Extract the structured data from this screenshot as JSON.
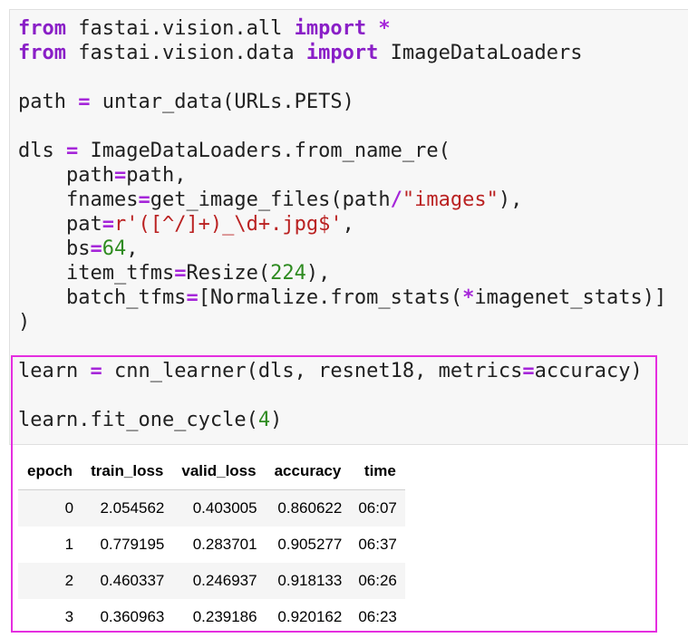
{
  "code": {
    "line1": {
      "kw1": "from",
      "mid": " fastai.vision.all ",
      "kw2": "import",
      "sp": " ",
      "star": "*"
    },
    "line2": {
      "kw1": "from",
      "mid": " fastai.vision.data ",
      "kw2": "import",
      "rest": " ImageDataLoaders"
    },
    "line4": {
      "a": "path ",
      "eq": "=",
      "b": " untar_data(URLs.PETS)"
    },
    "line6": {
      "a": "dls ",
      "eq": "=",
      "b": " ImageDataLoaders.from_name_re("
    },
    "line7": {
      "a": "    path",
      "eq": "=",
      "b": "path,"
    },
    "line8": {
      "a": "    fnames",
      "eq": "=",
      "b": "get_image_files(path",
      "slash": "/",
      "str": "\"images\"",
      "c": "),"
    },
    "line9": {
      "a": "    pat",
      "eq": "=",
      "str": "r'([^/]+)_\\d+.jpg$'",
      "c": ","
    },
    "line10": {
      "a": "    bs",
      "eq": "=",
      "num": "64",
      "c": ","
    },
    "line11": {
      "a": "    item_tfms",
      "eq": "=",
      "b": "Resize(",
      "num": "224",
      "c": "),"
    },
    "line12": {
      "a": "    batch_tfms",
      "eq": "=",
      "b": "[Normalize.from_stats(",
      "star": "*",
      "c": "imagenet_stats)]"
    },
    "line13": {
      "a": ")"
    },
    "line15": {
      "a": "learn ",
      "eq": "=",
      "b": " cnn_learner(dls, resnet18, metrics",
      "eq2": "=",
      "c": "accuracy)"
    },
    "line17": {
      "a": "learn.fit_one_cycle(",
      "num": "4",
      "c": ")"
    }
  },
  "output_table": {
    "headers": [
      "epoch",
      "train_loss",
      "valid_loss",
      "accuracy",
      "time"
    ],
    "rows": [
      [
        "0",
        "2.054562",
        "0.403005",
        "0.860622",
        "06:07"
      ],
      [
        "1",
        "0.779195",
        "0.283701",
        "0.905277",
        "06:37"
      ],
      [
        "2",
        "0.460337",
        "0.246937",
        "0.918133",
        "06:26"
      ],
      [
        "3",
        "0.360963",
        "0.239186",
        "0.920162",
        "06:23"
      ]
    ]
  },
  "colors": {
    "highlight_border": "#e52ee0",
    "keyword": "#8a1fc7",
    "string": "#ba2121",
    "number": "#2e8b20"
  }
}
